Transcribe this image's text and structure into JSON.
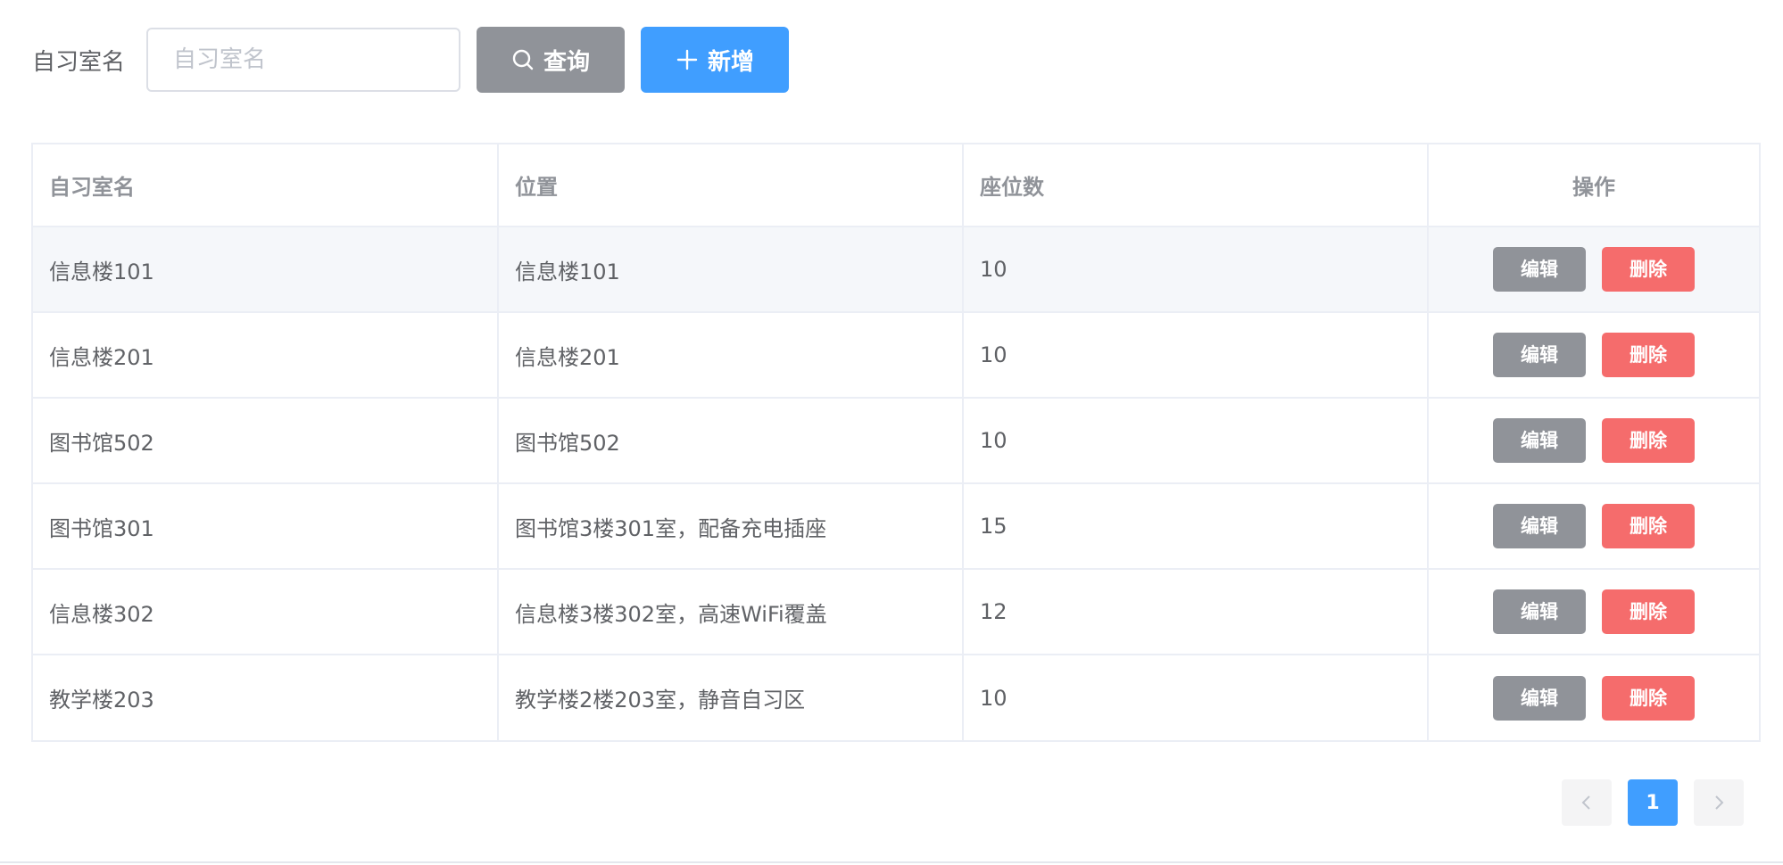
{
  "search": {
    "label": "自习室名",
    "placeholder": "自习室名",
    "value": "",
    "query_label": "查询",
    "add_label": "新增"
  },
  "table": {
    "headers": {
      "name": "自习室名",
      "location": "位置",
      "seats": "座位数",
      "actions": "操作"
    },
    "rows": [
      {
        "name": "信息楼101",
        "location": "信息楼101",
        "seats": "10"
      },
      {
        "name": "信息楼201",
        "location": "信息楼201",
        "seats": "10"
      },
      {
        "name": "图书馆502",
        "location": "图书馆502",
        "seats": "10"
      },
      {
        "name": "图书馆301",
        "location": "图书馆3楼301室，配备充电插座",
        "seats": "15"
      },
      {
        "name": "信息楼302",
        "location": "信息楼3楼302室，高速WiFi覆盖",
        "seats": "12"
      },
      {
        "name": "教学楼203",
        "location": "教学楼2楼203室，静音自习区",
        "seats": "10"
      }
    ],
    "edit_label": "编辑",
    "delete_label": "删除"
  },
  "pagination": {
    "current_page": "1",
    "prev_icon": "chevron-left-icon",
    "next_icon": "chevron-right-icon"
  },
  "colors": {
    "primary": "#409eff",
    "info": "#909399",
    "danger": "#f56c6c"
  }
}
